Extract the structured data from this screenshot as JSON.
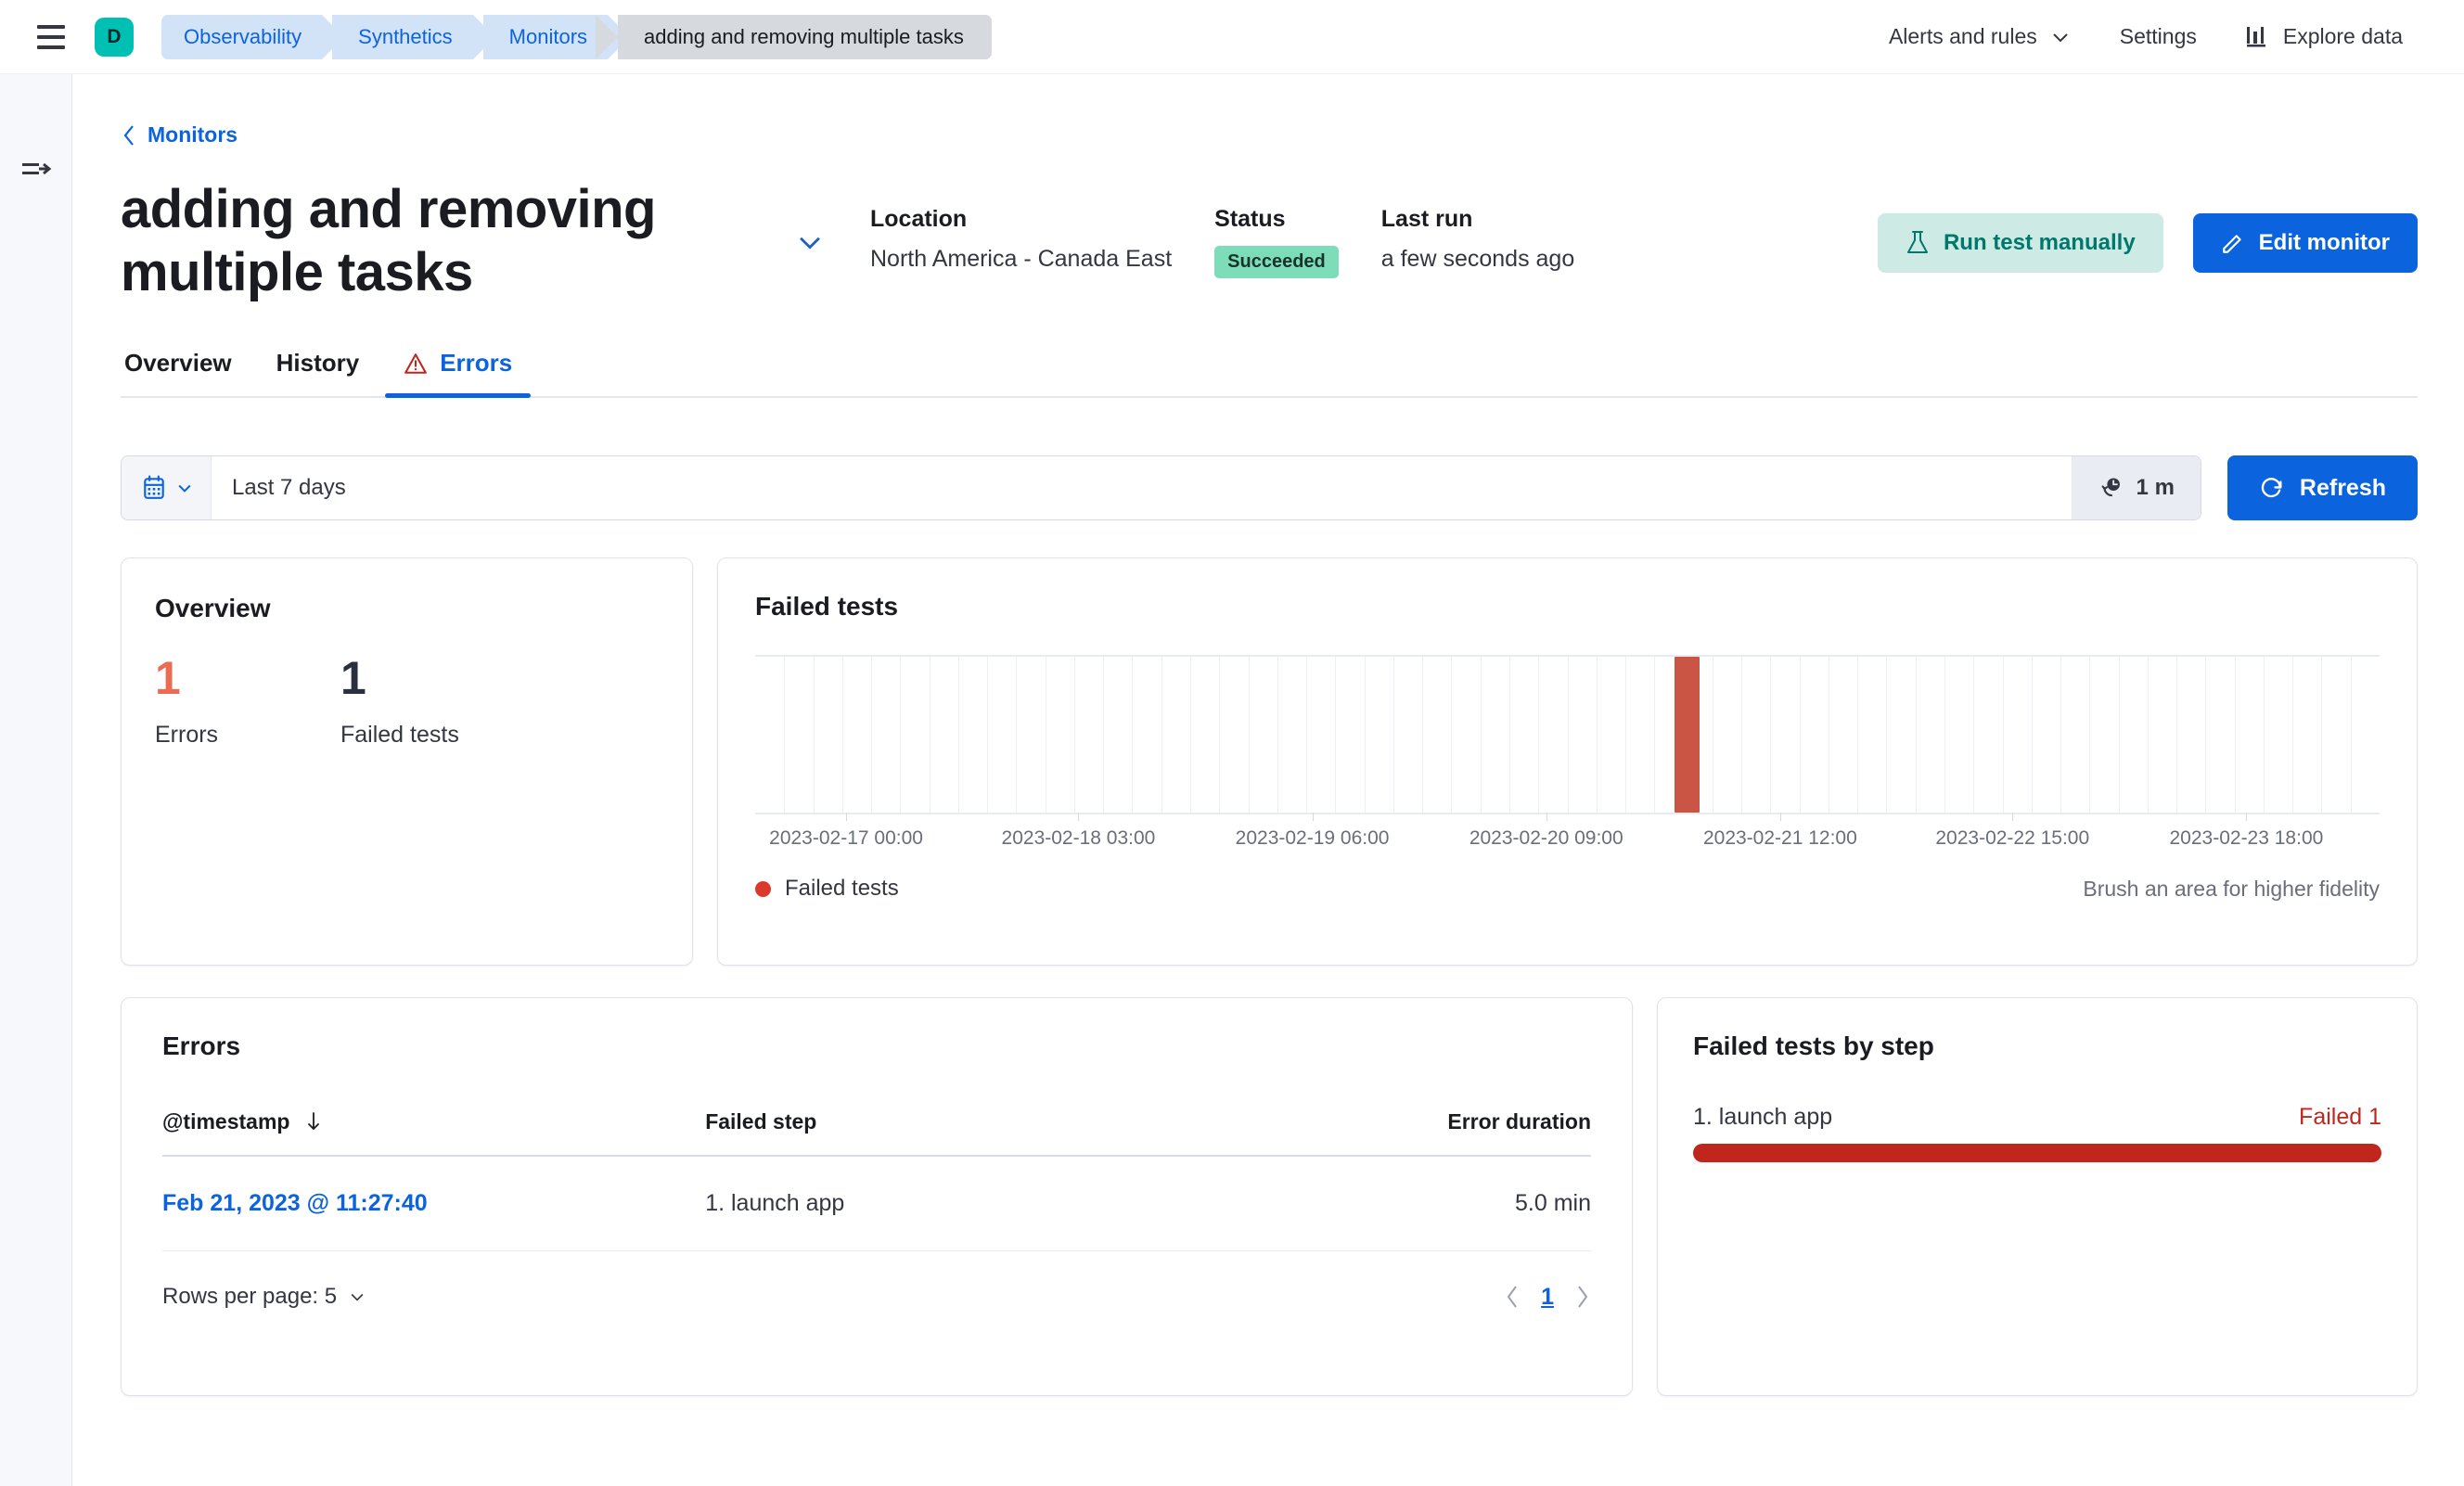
{
  "chrome": {
    "menu_icon": "hamburger-icon",
    "avatar_initial": "D",
    "breadcrumbs": [
      {
        "label": "Observability",
        "active": false
      },
      {
        "label": "Synthetics",
        "active": false
      },
      {
        "label": "Monitors",
        "active": false
      },
      {
        "label": "adding and removing multiple tasks",
        "active": true
      }
    ],
    "links": [
      {
        "label": "Alerts and rules",
        "icon": "chevron-down-icon"
      },
      {
        "label": "Settings",
        "icon": ""
      },
      {
        "label": "Explore data",
        "icon": "bar-chart-icon"
      }
    ]
  },
  "rail": {
    "toggle_icon": "collapse-sidebar-icon"
  },
  "page": {
    "back_label": "Monitors",
    "back_icon": "chevron-left-icon",
    "title": "adding and removing multiple tasks",
    "title_caret_icon": "chevron-down-icon",
    "meta": [
      {
        "label": "Location",
        "value": "North America - Canada East",
        "type": "text"
      },
      {
        "label": "Status",
        "value": "Succeeded",
        "type": "badge"
      },
      {
        "label": "Last run",
        "value": "a few seconds ago",
        "type": "text"
      }
    ],
    "actions": {
      "run_test": {
        "label": "Run test manually",
        "icon": "flask-icon"
      },
      "edit_monitor": {
        "label": "Edit monitor",
        "icon": "pencil-icon"
      }
    },
    "tabs": [
      {
        "label": "Overview",
        "active": false,
        "icon": ""
      },
      {
        "label": "History",
        "active": false,
        "icon": ""
      },
      {
        "label": "Errors",
        "active": true,
        "icon": "warning-triangle-icon"
      }
    ]
  },
  "date_bar": {
    "calendar_icon": "calendar-icon",
    "caret_icon": "chevron-down-icon",
    "range_value": "Last 7 days",
    "range_placeholder": "Last 7 days",
    "interval_icon": "clock-refresh-icon",
    "interval_value": "1 m",
    "refresh_icon": "refresh-icon",
    "refresh_label": "Refresh"
  },
  "overview": {
    "title": "Overview",
    "stats": [
      {
        "value": "1",
        "label": "Errors",
        "tone": "danger"
      },
      {
        "value": "1",
        "label": "Failed tests",
        "tone": "neutral"
      }
    ]
  },
  "failed_tests_panel": {
    "title": "Failed tests",
    "legend_label": "Failed tests",
    "legend_color": "#d93a2a",
    "brush_hint": "Brush an area for higher fidelity"
  },
  "errors_panel": {
    "title": "Errors",
    "columns": [
      {
        "label": "@timestamp",
        "sort_icon": "sort-descending-icon",
        "align": "left"
      },
      {
        "label": "Failed step",
        "sort_icon": "",
        "align": "left"
      },
      {
        "label": "Error duration",
        "sort_icon": "",
        "align": "right"
      }
    ],
    "rows": [
      {
        "timestamp": "Feb 21, 2023 @ 11:27:40",
        "failed_step": "1. launch app",
        "error_duration": "5.0 min"
      }
    ],
    "rows_per_page_label": "Rows per page: 5",
    "rows_per_page_caret": "chevron-down-icon",
    "pager": {
      "prev_icon": "chevron-left-icon",
      "next_icon": "chevron-right-icon",
      "current_page": "1"
    }
  },
  "step_panel": {
    "title": "Failed tests by step",
    "step_name": "1. launch app",
    "step_count": "Failed 1",
    "bar_color": "#c0261c",
    "bar_percent": 100
  },
  "chart_data": {
    "type": "bar",
    "title": "Failed tests",
    "xlabel": "",
    "ylabel": "",
    "grid": true,
    "legend_position": "bottom-left",
    "series": [
      {
        "name": "Failed tests",
        "color": "#ca5545"
      }
    ],
    "x_tick_labels": [
      "2023-02-17 00:00",
      "2023-02-18 03:00",
      "2023-02-19 06:00",
      "2023-02-20 09:00",
      "2023-02-21 12:00",
      "2023-02-22 15:00",
      "2023-02-23 18:00"
    ],
    "x_tick_positions_pct": [
      5.6,
      19.9,
      34.3,
      48.7,
      63.1,
      77.4,
      91.8
    ],
    "num_bins": 56,
    "bars": [
      {
        "bin_index": 32,
        "x_pct": 56.6,
        "value": 1
      }
    ],
    "ylim": [
      0,
      1
    ]
  }
}
